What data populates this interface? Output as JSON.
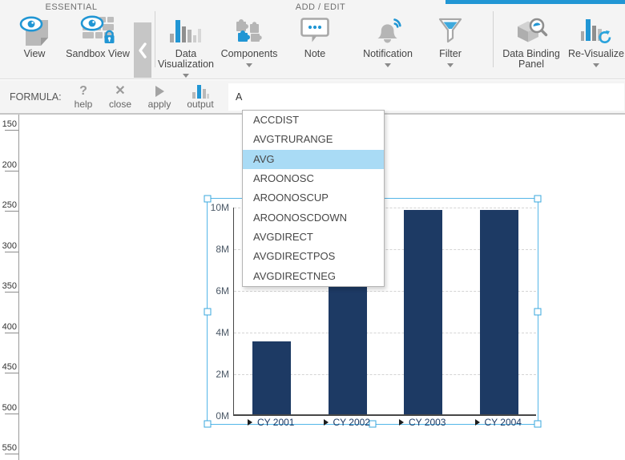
{
  "ribbon": {
    "accent_color": "#2196d4",
    "groups": {
      "essential": {
        "label": "ESSENTIAL"
      },
      "add_edit": {
        "label": "ADD / EDIT"
      }
    },
    "items": {
      "view": "View",
      "sandbox_view": "Sandbox View",
      "data_visualization": "Data Visualization",
      "components": "Components",
      "note": "Note",
      "notification": "Notification",
      "filter": "Filter",
      "data_binding_panel": "Data Binding Panel",
      "re_visualize": "Re-Visualize"
    }
  },
  "formula_bar": {
    "label": "FORMULA:",
    "buttons": {
      "help": "help",
      "close": "close",
      "apply": "apply",
      "output": "output"
    },
    "input_value": "A"
  },
  "autocomplete": {
    "items": [
      "ACCDIST",
      "AVGTRURANGE",
      "AVG",
      "AROONOSC",
      "AROONOSCUP",
      "AROONOSCDOWN",
      "AVGDIRECT",
      "AVGDIRECTPOS",
      "AVGDIRECTNEG"
    ],
    "highlighted": "AVG",
    "highlight_color": "#a9dbf5"
  },
  "ruler": {
    "marks": [
      150,
      200,
      250,
      300,
      350,
      400,
      450,
      500,
      550
    ]
  },
  "chart_data": {
    "type": "bar",
    "categories": [
      "CY 2001",
      "CY 2002",
      "CY 2003",
      "CY 2004"
    ],
    "values": [
      3.5,
      6.1,
      9.8,
      9.8
    ],
    "unit": "M",
    "y_ticks": [
      "0M",
      "2M",
      "4M",
      "6M",
      "8M",
      "10M"
    ],
    "ylim": [
      0,
      10
    ],
    "title": "",
    "xlabel": "",
    "ylabel": "",
    "grid": true,
    "bar_color": "#1d3a64",
    "selected": true
  }
}
